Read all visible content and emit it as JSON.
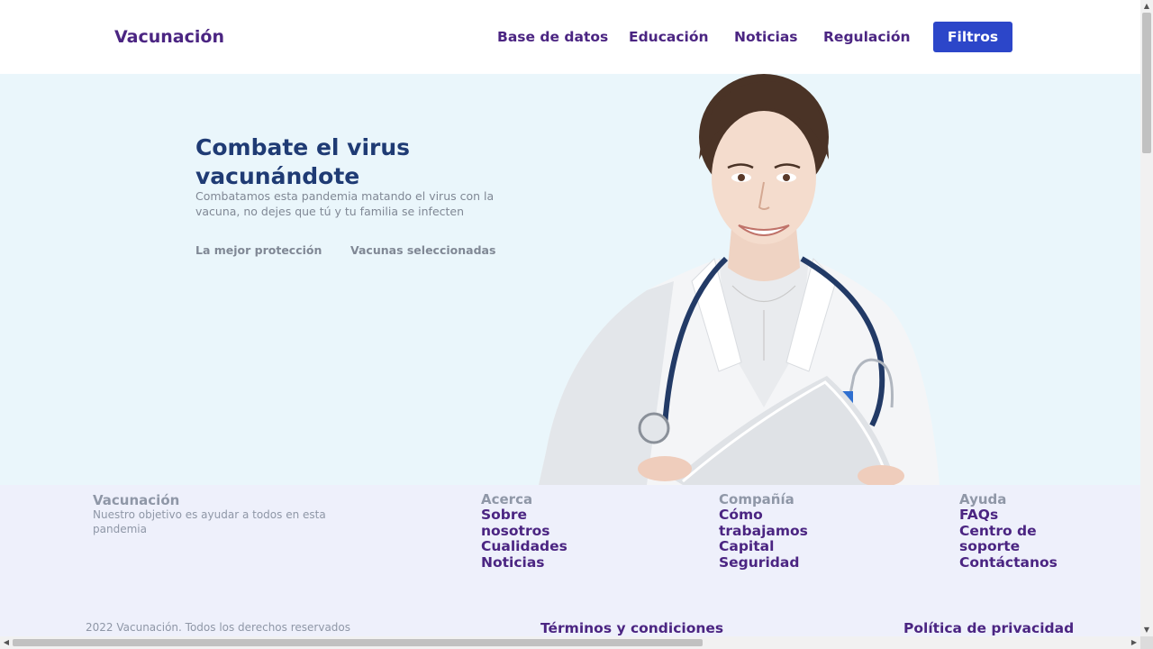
{
  "header": {
    "brand": "Vacunación",
    "nav": [
      "Base de datos",
      "Educación",
      "Noticias",
      "Regulación"
    ],
    "filter_button": "Filtros"
  },
  "hero": {
    "title": "Combate el virus vacunándote",
    "subtitle": "Combatamos esta pandemia matando el virus con la vacuna, no dejes que tú y tu familia se infecten",
    "links": [
      "La mejor protección",
      "Vacunas seleccionadas"
    ],
    "image": "doctor-with-stethoscope"
  },
  "footer": {
    "brand": "Vacunación",
    "description": "Nuestro objetivo es ayudar a todos en esta pandemia",
    "columns": [
      {
        "title": "Acerca",
        "links": [
          "Sobre nosotros",
          "Cualidades",
          "Noticias"
        ]
      },
      {
        "title": "Compañía",
        "links": [
          "Cómo trabajamos",
          "Capital",
          "Seguridad"
        ]
      },
      {
        "title": "Ayuda",
        "links": [
          "FAQs",
          "Centro de soporte",
          "Contáctanos"
        ]
      }
    ],
    "copyright": "2022 Vacunación. Todos los derechos reservados",
    "terms": "Términos y condiciones",
    "privacy": "Política de privacidad"
  },
  "colors": {
    "brand_purple": "#4b2582",
    "button_blue": "#2c46c9",
    "hero_bg": "#eaf6fb",
    "footer_bg": "#eef0fb",
    "title_navy": "#1f3b74"
  }
}
